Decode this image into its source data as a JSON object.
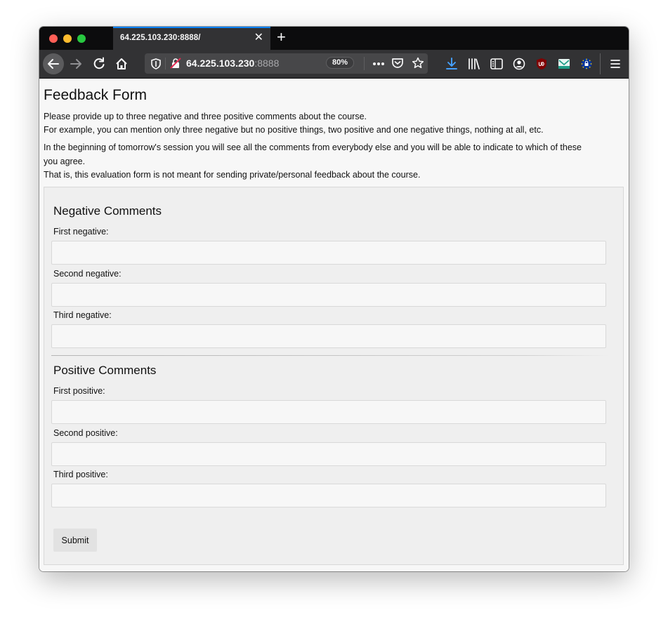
{
  "browser": {
    "tab_title": "64.225.103.230:8888/",
    "tab_close_glyph": "✕",
    "new_tab_glyph": "+",
    "url_host": "64.225.103.230",
    "url_port": ":8888",
    "zoom": "80%",
    "icons": [
      "back-arrow-icon",
      "forward-arrow-icon",
      "reload-icon",
      "home-icon",
      "shield-icon",
      "insecure-lock-icon",
      "more-actions-icon",
      "pocket-icon",
      "bookmark-star-icon",
      "download-icon",
      "library-icon",
      "sidebar-icon",
      "account-icon",
      "ublock-icon",
      "mail-extension-icon",
      "privacy-extension-icon",
      "menu-icon"
    ],
    "colors": {
      "accent": "#0a84ff",
      "chrome": "#323234",
      "tabstrip": "#0c0c0d"
    }
  },
  "page": {
    "title": "Feedback Form",
    "intro": {
      "line1": "Please provide up to three negative and three positive comments about the course.",
      "line2": "For example, you can mention only three negative but no positive things, two positive and one negative things, nothing at all, etc.",
      "line3": "In the beginning of tomorrow's session you will see all the comments from everybody else and you will be able to indicate to which of these",
      "line4": "you agree.",
      "line5": "That is, this evaluation form is not meant for sending private/personal feedback about the course."
    }
  },
  "form": {
    "negative": {
      "heading": "Negative Comments",
      "fields": [
        {
          "label": "First negative:",
          "value": ""
        },
        {
          "label": "Second negative:",
          "value": ""
        },
        {
          "label": "Third negative:",
          "value": ""
        }
      ]
    },
    "positive": {
      "heading": "Positive Comments",
      "fields": [
        {
          "label": "First positive:",
          "value": ""
        },
        {
          "label": "Second positive:",
          "value": ""
        },
        {
          "label": "Third positive:",
          "value": ""
        }
      ]
    },
    "submit_label": "Submit"
  }
}
